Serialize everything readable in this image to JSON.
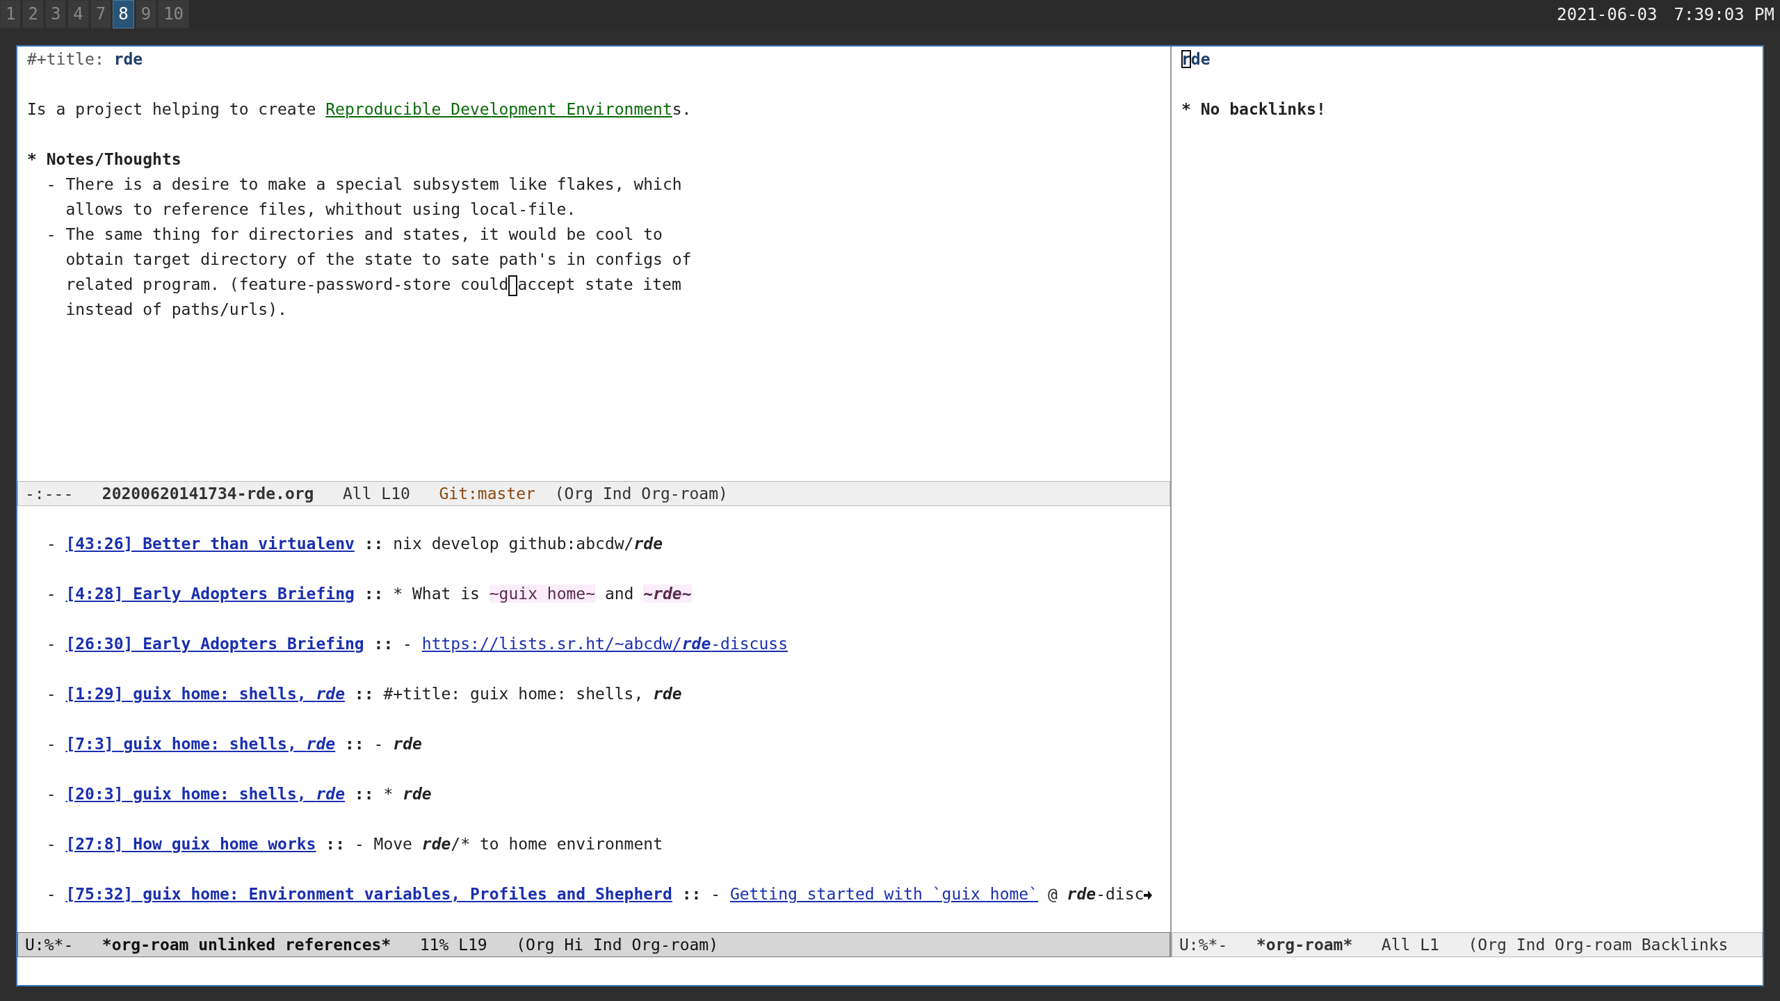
{
  "topbar": {
    "workspaces": [
      {
        "label": "1",
        "selected": false
      },
      {
        "label": "2",
        "selected": false
      },
      {
        "label": "3",
        "selected": false
      },
      {
        "label": "4",
        "selected": false
      },
      {
        "label": "7",
        "selected": false
      },
      {
        "label": "8",
        "selected": true
      },
      {
        "label": "9",
        "selected": false
      },
      {
        "label": "10",
        "selected": false
      }
    ],
    "date": "2021-06-03",
    "time": "7:39:03 PM"
  },
  "note_buffer": {
    "title_keyword": "#+title:",
    "title": "rde",
    "paragraph": {
      "before": "Is a project helping to create ",
      "link": "Reproducible Development Environment",
      "after": "s."
    },
    "heading": {
      "star": "*",
      "text": "Notes/Thoughts"
    },
    "items": [
      {
        "bullet": "-",
        "lines": [
          {
            "kind": "text",
            "text": "There is a desire to make a special subsystem like flakes, which"
          },
          {
            "kind": "text",
            "text": "allows to reference files, whithout using local-file."
          }
        ]
      },
      {
        "bullet": "-",
        "lines": [
          {
            "kind": "text",
            "text": "The same thing for directories and states, it would be cool to"
          },
          {
            "kind": "text",
            "text": "obtain target directory of the state to sate path's in configs of"
          },
          {
            "kind": "cursor",
            "before": "related program. (feature-password-store could",
            "after": "accept state item"
          },
          {
            "kind": "text",
            "text": "instead of paths/urls)."
          }
        ]
      }
    ]
  },
  "note_modeline": {
    "active": false,
    "status": "-:---",
    "buffer": "20200620141734-rde.org",
    "position": "All L10",
    "vc": "Git:master",
    "modes": "(Org Ind Org-roam)"
  },
  "references": [
    {
      "bullet": "-",
      "title": [
        {
          "kind": "text",
          "text": "[43:26] Better than virtualenv"
        }
      ],
      "separator": "::",
      "snippet": [
        {
          "kind": "text",
          "text": "nix develop github:abcdw/"
        },
        {
          "kind": "match",
          "text": "rde"
        }
      ]
    },
    {
      "bullet": "-",
      "title": [
        {
          "kind": "text",
          "text": "[4:28] Early Adopters Briefing"
        }
      ],
      "separator": "::",
      "snippet": [
        {
          "kind": "text",
          "text": "* What is "
        },
        {
          "kind": "code",
          "text": "~guix home~"
        },
        {
          "kind": "text",
          "text": " and "
        },
        {
          "kind": "codematch",
          "text": "~rde~"
        }
      ]
    },
    {
      "bullet": "-",
      "title": [
        {
          "kind": "text",
          "text": "[26:30] Early Adopters Briefing"
        }
      ],
      "separator": "::",
      "snippet": [
        {
          "kind": "text",
          "text": "- "
        },
        {
          "kind": "url",
          "text": "https://lists.sr.ht/~abcdw/"
        },
        {
          "kind": "urlmatch",
          "text": "rde"
        },
        {
          "kind": "url",
          "text": "-discuss"
        }
      ]
    },
    {
      "bullet": "-",
      "title": [
        {
          "kind": "text",
          "text": "[1:29] guix home: shells, "
        },
        {
          "kind": "match",
          "text": "rde"
        }
      ],
      "separator": "::",
      "snippet": [
        {
          "kind": "text",
          "text": "#+title: guix home: shells, "
        },
        {
          "kind": "match",
          "text": "rde"
        }
      ]
    },
    {
      "bullet": "-",
      "title": [
        {
          "kind": "text",
          "text": "[7:3] guix home: shells, "
        },
        {
          "kind": "match",
          "text": "rde"
        }
      ],
      "separator": "::",
      "snippet": [
        {
          "kind": "text",
          "text": "- "
        },
        {
          "kind": "match",
          "text": "rde"
        }
      ]
    },
    {
      "bullet": "-",
      "title": [
        {
          "kind": "text",
          "text": "[20:3] guix home: shells, "
        },
        {
          "kind": "match",
          "text": "rde"
        }
      ],
      "separator": "::",
      "snippet": [
        {
          "kind": "text",
          "text": "* "
        },
        {
          "kind": "match",
          "text": "rde"
        }
      ]
    },
    {
      "bullet": "-",
      "title": [
        {
          "kind": "text",
          "text": "[27:8] How guix home works"
        }
      ],
      "separator": "::",
      "snippet": [
        {
          "kind": "text",
          "text": "- Move "
        },
        {
          "kind": "match",
          "text": "rde"
        },
        {
          "kind": "text",
          "text": "/* to home environment"
        }
      ]
    },
    {
      "bullet": "-",
      "title": [
        {
          "kind": "text",
          "text": "[75:32] guix home: Environment variables, Profiles and Shepherd"
        }
      ],
      "separator": "::",
      "truncated": true,
      "snippet": [
        {
          "kind": "text",
          "text": "- "
        },
        {
          "kind": "url",
          "text": "Getting started with `guix home`"
        },
        {
          "kind": "text",
          "text": " @ "
        },
        {
          "kind": "match",
          "text": "rde"
        },
        {
          "kind": "text",
          "text": "-disc"
        }
      ]
    }
  ],
  "references_modeline": {
    "active": true,
    "status": "U:%*-",
    "buffer": "*org-roam unlinked references*",
    "position": "11% L19",
    "modes": "(Org Hi Ind Org-roam)"
  },
  "roam_buffer": {
    "title_cursor": "r",
    "title_rest": "de",
    "heading": {
      "star": "*",
      "text": "No backlinks!"
    }
  },
  "roam_modeline": {
    "active": false,
    "status": "U:%*-",
    "buffer": "*org-roam*",
    "position": "All L1",
    "modes": "(Org Ind Org-roam Backlinks"
  }
}
